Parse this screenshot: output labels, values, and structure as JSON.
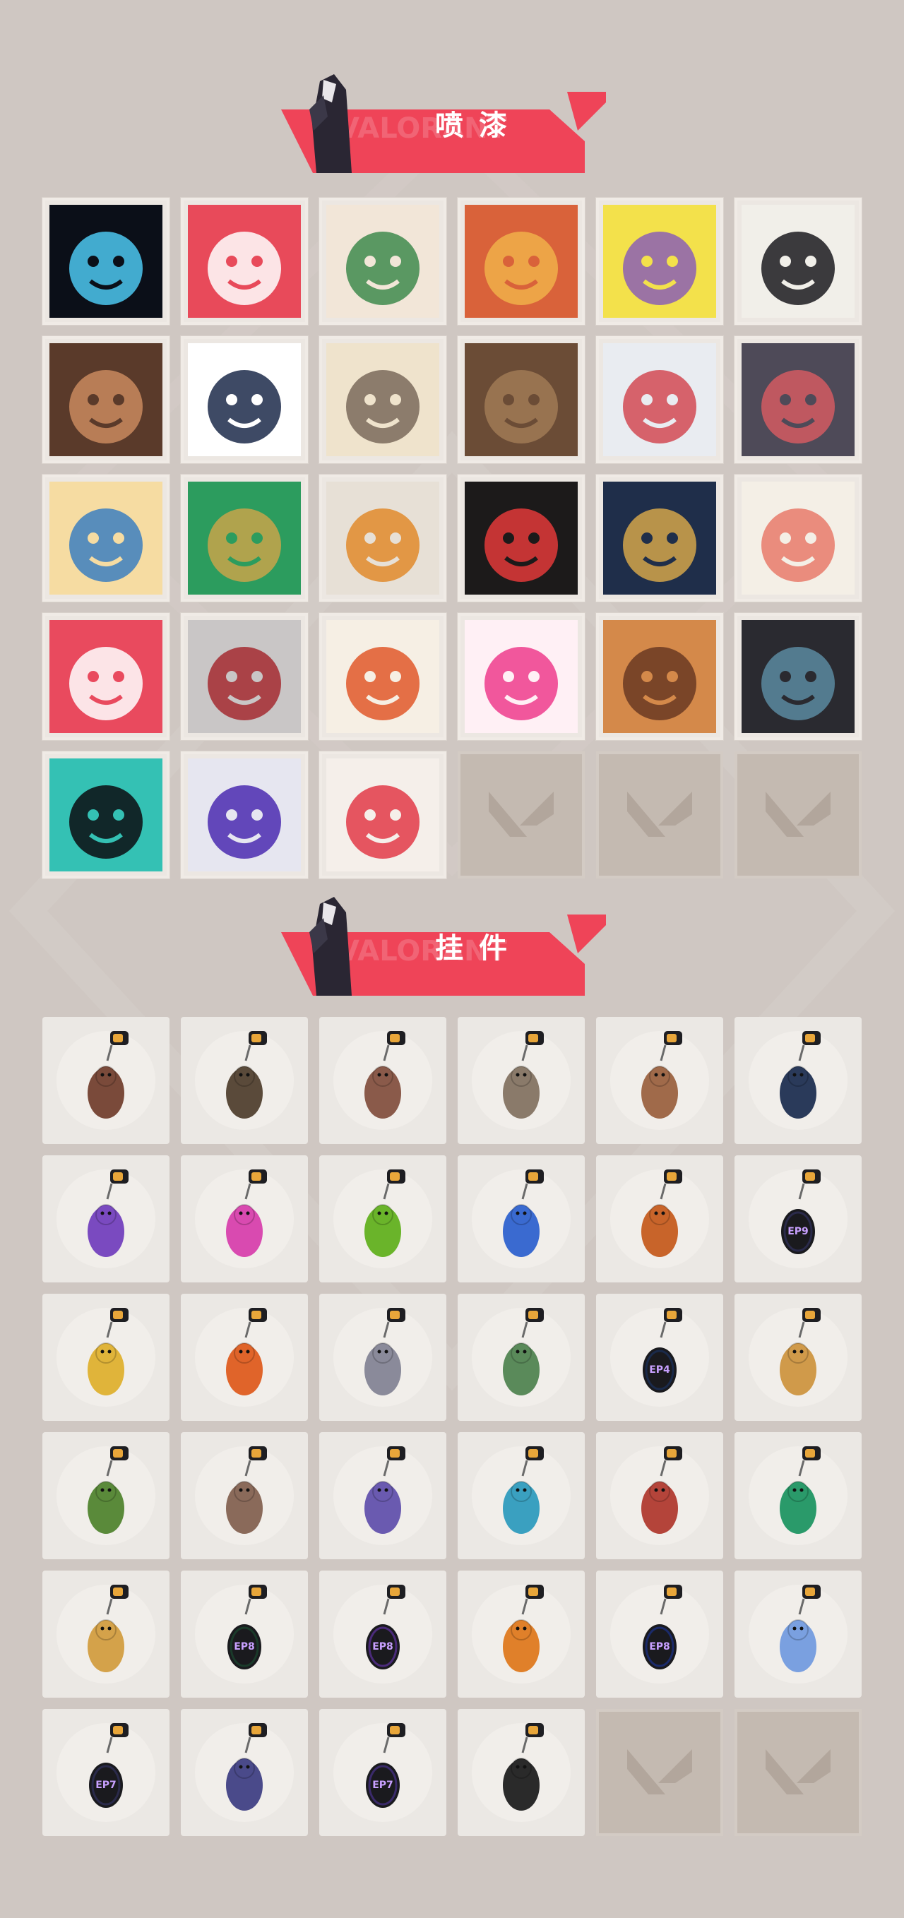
{
  "sections": {
    "sprays": {
      "title": "喷漆",
      "watermark": "VALORANT",
      "items": [
        {
          "icon": "neon-glyph-spray-icon"
        },
        {
          "icon": "bullet-zero-spray-icon"
        },
        {
          "icon": "killjoy-laugh-spray-icon"
        },
        {
          "icon": "raze-grin-spray-icon"
        },
        {
          "icon": "pirate-hat-spray-icon"
        },
        {
          "icon": "number-01-agent-spray-icon"
        },
        {
          "icon": "bearded-laugh-spray-icon"
        },
        {
          "icon": "wink-straw-spray-icon"
        },
        {
          "icon": "old-man-smirk-spray-icon"
        },
        {
          "icon": "smug-face-spray-icon"
        },
        {
          "icon": "white-hair-shout-spray-icon"
        },
        {
          "icon": "buck-tooth-scream-spray-icon"
        },
        {
          "icon": "blonde-stare-spray-icon"
        },
        {
          "icon": "gold-star-emblem-spray-icon"
        },
        {
          "icon": "duck-bill-spray-icon"
        },
        {
          "icon": "spray-can-banned-icon"
        },
        {
          "icon": "golden-cloud-waves-spray-icon"
        },
        {
          "icon": "glasses-shock-spray-icon"
        },
        {
          "icon": "pixel-heart-spray-icon"
        },
        {
          "icon": "red-x-button-spray-icon"
        },
        {
          "icon": "lion-dance-spray-icon"
        },
        {
          "icon": "neon-heart-spray-icon"
        },
        {
          "icon": "bearded-yawn-spray-icon"
        },
        {
          "icon": "masked-agent-spray-icon"
        },
        {
          "icon": "splatter-v-logo-spray-icon"
        },
        {
          "icon": "purple-graffiti-tag-spray-icon"
        },
        {
          "icon": "red-v-logo-drip-spray-icon"
        },
        {
          "empty": true
        },
        {
          "empty": true
        },
        {
          "empty": true
        }
      ]
    },
    "charms": {
      "title": "挂件",
      "watermark": "VALORANT",
      "items": [
        {
          "icon": "teddy-bear-bell-charm-icon"
        },
        {
          "icon": "brown-gun-block-charm-icon"
        },
        {
          "icon": "agent-figure-charm-icon"
        },
        {
          "icon": "cowboy-figure-charm-icon"
        },
        {
          "icon": "cardboard-box-charm-icon"
        },
        {
          "icon": "cat-figure-tassel-charm-icon"
        },
        {
          "icon": "purple-crystal-blade-charm-icon"
        },
        {
          "icon": "lava-lamp-charm-icon"
        },
        {
          "icon": "green-pager-charm-icon"
        },
        {
          "icon": "blue-robot-charm-icon"
        },
        {
          "icon": "radio-device-charm-icon"
        },
        {
          "icon": "ep9-medallion-charm-icon",
          "label": "EP9"
        },
        {
          "icon": "taco-critter-charm-icon"
        },
        {
          "icon": "skewer-charm-icon"
        },
        {
          "icon": "silver-agent-plaque-charm-icon"
        },
        {
          "icon": "green-robot-charm-icon"
        },
        {
          "icon": "ep4-medallion-charm-icon",
          "label": "EP4"
        },
        {
          "icon": "fox-plush-charm-icon"
        },
        {
          "icon": "green-mask-charm-icon"
        },
        {
          "icon": "raccoon-plush-charm-icon"
        },
        {
          "icon": "mech-robot-charm-icon"
        },
        {
          "icon": "blue-sword-charm-icon"
        },
        {
          "icon": "red-octopus-charm-icon"
        },
        {
          "icon": "emerald-diamond-charm-icon"
        },
        {
          "icon": "sun-cloud-charm-icon"
        },
        {
          "icon": "ep8-green-medallion-charm-icon",
          "label": "EP8"
        },
        {
          "icon": "ep8-purple-medallion-charm-icon",
          "label": "EP8"
        },
        {
          "icon": "orange-cat-charm-icon"
        },
        {
          "icon": "ep8-blue-medallion-charm-icon",
          "label": "EP8"
        },
        {
          "icon": "snowflake-charm-icon"
        },
        {
          "icon": "ep7-orange-medallion-charm-icon",
          "label": "EP7"
        },
        {
          "icon": "blue-tassel-charm-icon"
        },
        {
          "icon": "ep7-purple-medallion-charm-icon",
          "label": "EP7"
        },
        {
          "icon": "v-logo-medallion-charm-icon"
        },
        {
          "empty": true
        },
        {
          "empty": true
        }
      ]
    }
  },
  "colors": {
    "background": "#cfc7c2",
    "banner_red": "#ef4458",
    "tile_light": "#ece7e2",
    "empty_tile": "#c4bab1"
  }
}
